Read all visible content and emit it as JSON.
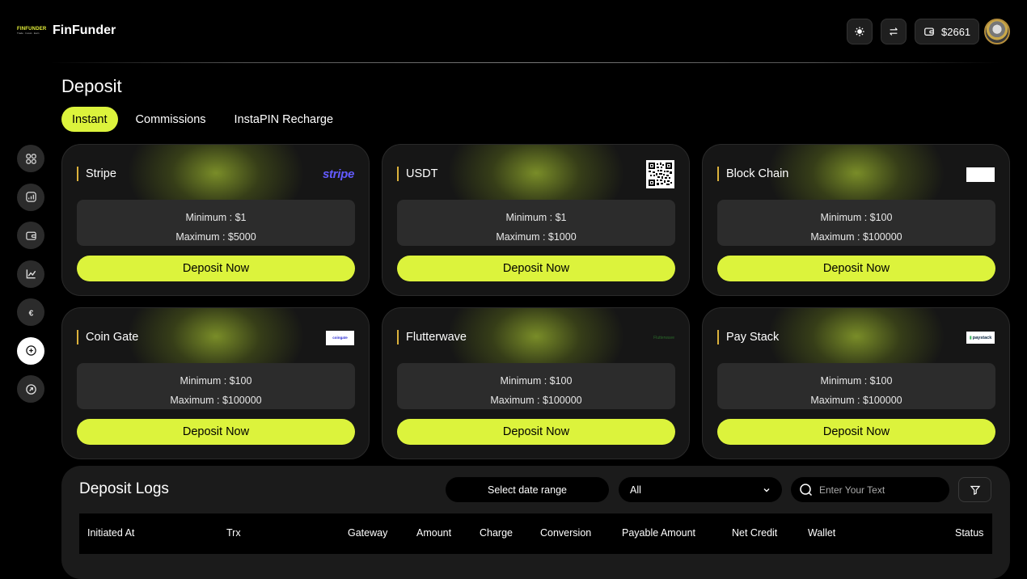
{
  "header": {
    "logo_line1": "FINFUNDER",
    "logo_line2": "Trade · Invest · Earn",
    "brand": "FinFunder",
    "balance": "$2661"
  },
  "sidebar": {
    "icons": [
      "dashboard-icon",
      "chart-box-icon",
      "wallet-icon",
      "line-chart-icon",
      "euro-icon",
      "plus-circle-icon",
      "arrow-up-right-circle-icon"
    ],
    "active_index": 5
  },
  "page": {
    "title": "Deposit"
  },
  "tabs": [
    "Instant",
    "Commissions",
    "InstaPIN Recharge"
  ],
  "gateways": [
    {
      "name": "Stripe",
      "logo": "stripe",
      "minimum": "Minimum : $1",
      "maximum": "Maximum : $5000",
      "button": "Deposit Now"
    },
    {
      "name": "USDT",
      "logo": "qr-code",
      "minimum": "Minimum : $1",
      "maximum": "Maximum : $1000",
      "button": "Deposit Now"
    },
    {
      "name": "Block Chain",
      "logo": "blank-logo",
      "minimum": "Minimum : $100",
      "maximum": "Maximum : $100000",
      "button": "Deposit Now"
    },
    {
      "name": "Coin Gate",
      "logo": "coingate",
      "minimum": "Minimum : $100",
      "maximum": "Maximum : $100000",
      "button": "Deposit Now"
    },
    {
      "name": "Flutterwave",
      "logo": "flutterwave",
      "minimum": "Minimum : $100",
      "maximum": "Maximum : $100000",
      "button": "Deposit Now"
    },
    {
      "name": "Pay Stack",
      "logo": "paystack",
      "minimum": "Minimum : $100",
      "maximum": "Maximum : $100000",
      "button": "Deposit Now"
    }
  ],
  "logos": {
    "stripe": "stripe",
    "coingate": "coingate",
    "flutterwave": "Flutterwave",
    "paystack": "paystack"
  },
  "logs": {
    "title": "Deposit Logs",
    "date_range": "Select date range",
    "select_value": "All",
    "search_placeholder": "Enter Your Text",
    "columns": [
      "Initiated At",
      "Trx",
      "Gateway",
      "Amount",
      "Charge",
      "Conversion",
      "Payable Amount",
      "Net Credit",
      "Wallet",
      "Status"
    ]
  },
  "colors": {
    "accent": "#dcf33c",
    "card_bg": "#161616",
    "name_bar": "#dcb23c"
  }
}
